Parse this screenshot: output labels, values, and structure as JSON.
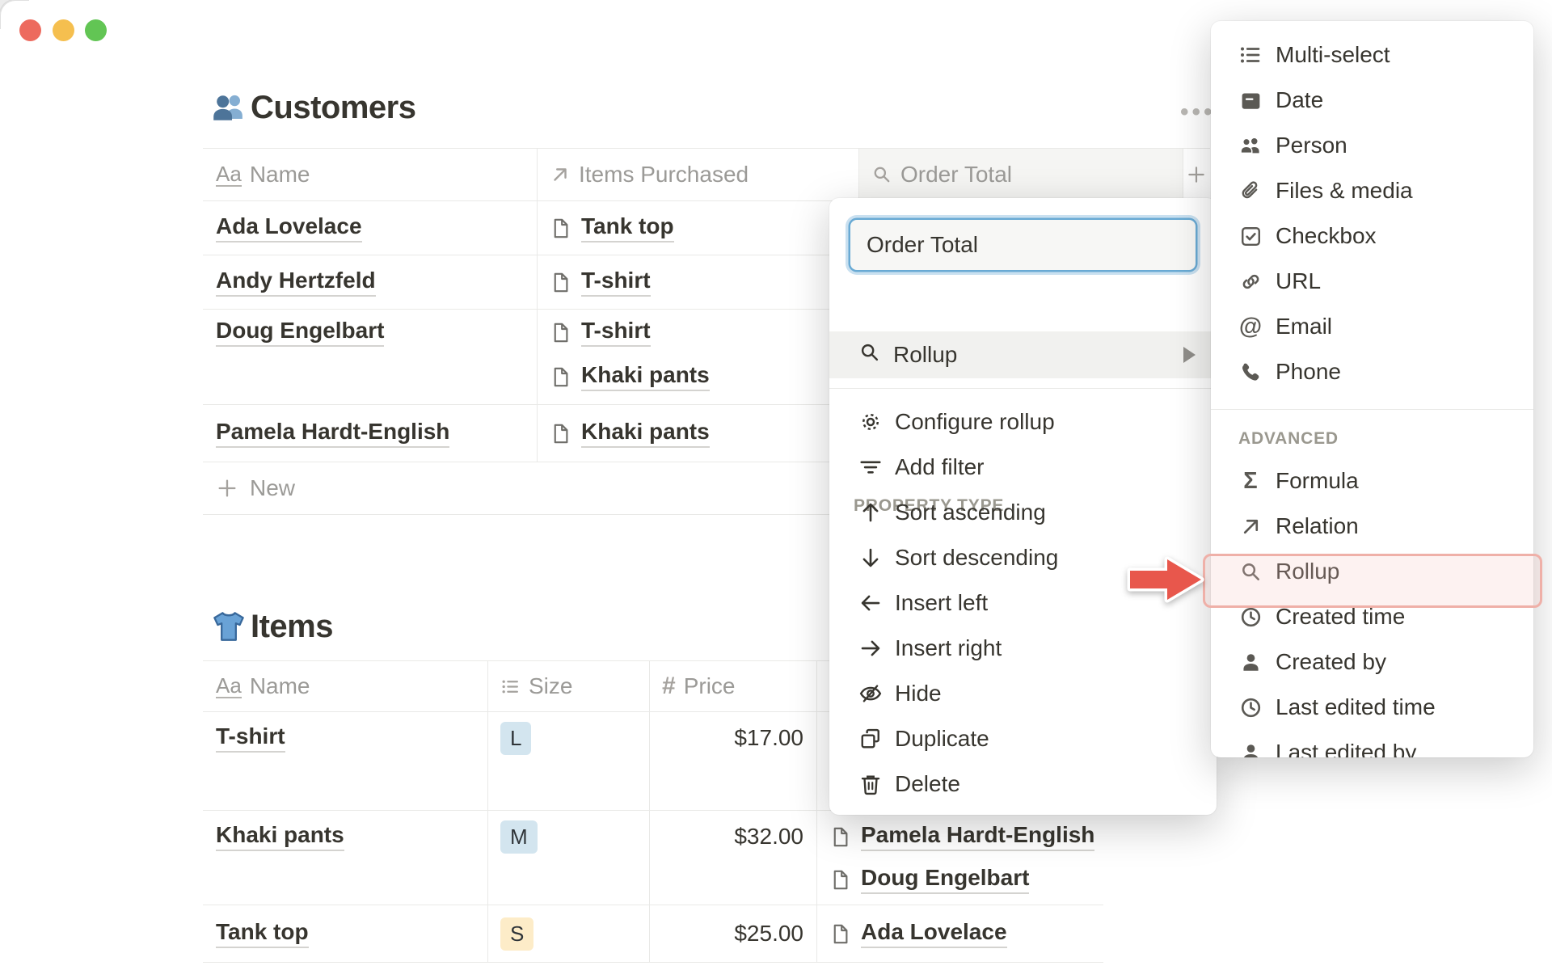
{
  "window": {
    "traffic_lights": [
      "close",
      "minimize",
      "zoom"
    ],
    "more_dots": "•••"
  },
  "glyphs": {
    "title_glyph": "Aa",
    "price_glyph": "#",
    "email_glyph": "@",
    "formula_glyph": "Σ"
  },
  "customers_table": {
    "title": "Customers",
    "title_icon": "busts-in-silhouette-emoji",
    "columns": [
      {
        "icon": "text-type-icon",
        "label": "Name"
      },
      {
        "icon": "relation-arrow-icon",
        "label": "Items Purchased"
      },
      {
        "icon": "rollup-search-icon",
        "label": "Order Total"
      },
      {
        "icon": "plus-icon",
        "label": ""
      }
    ],
    "rows": [
      {
        "name": "Ada Lovelace",
        "items": [
          "Tank top"
        ]
      },
      {
        "name": "Andy Hertzfeld",
        "items": [
          "T-shirt"
        ]
      },
      {
        "name": "Doug Engelbart",
        "items": [
          "T-shirt",
          "Khaki pants"
        ]
      },
      {
        "name": "Pamela Hardt-English",
        "items": [
          "Khaki pants"
        ]
      }
    ],
    "new_row_label": "New"
  },
  "items_table": {
    "title": "Items",
    "title_icon": "t-shirt-emoji",
    "columns": [
      {
        "icon": "text-type-icon",
        "label": "Name"
      },
      {
        "icon": "select-list-icon",
        "label": "Size"
      },
      {
        "icon": "number-hash-icon",
        "label": "Price"
      },
      {
        "icon": "hidden-behind-menu",
        "label": ""
      }
    ],
    "rows": [
      {
        "name": "T-shirt",
        "size": "L",
        "size_color": "#d3e5ef",
        "price": "$17.00",
        "customers": []
      },
      {
        "name": "Khaki pants",
        "size": "M",
        "size_color": "#d3e5ef",
        "price": "$32.00",
        "customers": [
          "Pamela Hardt-English",
          "Doug Engelbart"
        ]
      },
      {
        "name": "Tank top",
        "size": "S",
        "size_color": "#fdecc8",
        "price": "$25.00",
        "customers": [
          "Ada Lovelace"
        ]
      }
    ]
  },
  "property_menu": {
    "name_input_value": "Order Total",
    "section_label": "PROPERTY TYPE",
    "current_type": {
      "icon": "rollup-search-icon",
      "label": "Rollup",
      "has_submenu": true
    },
    "actions": [
      {
        "icon": "gear-icon",
        "label": "Configure rollup"
      },
      {
        "icon": "filter-icon",
        "label": "Add filter"
      },
      {
        "icon": "arrow-up-icon",
        "label": "Sort ascending"
      },
      {
        "icon": "arrow-down-icon",
        "label": "Sort descending"
      },
      {
        "icon": "arrow-left-icon",
        "label": "Insert left"
      },
      {
        "icon": "arrow-right-icon",
        "label": "Insert right"
      },
      {
        "icon": "eye-slash-icon",
        "label": "Hide"
      },
      {
        "icon": "duplicate-icon",
        "label": "Duplicate"
      },
      {
        "icon": "trash-icon",
        "label": "Delete"
      }
    ]
  },
  "type_submenu": {
    "basic": [
      {
        "icon": "multi-select-list-icon",
        "label": "Multi-select"
      },
      {
        "icon": "calendar-icon",
        "label": "Date"
      },
      {
        "icon": "people-icon",
        "label": "Person"
      },
      {
        "icon": "paperclip-icon",
        "label": "Files & media"
      },
      {
        "icon": "checkbox-icon",
        "label": "Checkbox"
      },
      {
        "icon": "link-icon",
        "label": "URL"
      },
      {
        "icon": "at-sign-icon",
        "label": "Email"
      },
      {
        "icon": "phone-icon",
        "label": "Phone"
      }
    ],
    "advanced_label": "ADVANCED",
    "advanced": [
      {
        "icon": "sigma-icon",
        "label": "Formula"
      },
      {
        "icon": "relation-arrow-icon",
        "label": "Relation"
      },
      {
        "icon": "rollup-search-icon",
        "label": "Rollup",
        "highlighted": true
      },
      {
        "icon": "clock-icon",
        "label": "Created time"
      },
      {
        "icon": "person-icon",
        "label": "Created by"
      },
      {
        "icon": "clock-icon",
        "label": "Last edited time"
      },
      {
        "icon": "person-icon",
        "label": "Last edited by",
        "clipped": true
      }
    ]
  },
  "annotation": {
    "target": "Rollup",
    "arrow_color": "#e8574c",
    "highlight_fill": "#fdf0ee",
    "highlight_border": "#efb0a8"
  },
  "colors": {
    "accent_blue_focus": "#69aad4",
    "tag_blue": "#d3e5ef",
    "tag_yellow": "#fdecc8",
    "text": "#37352f",
    "muted": "#9b9a97",
    "border": "#e9e9e7"
  }
}
